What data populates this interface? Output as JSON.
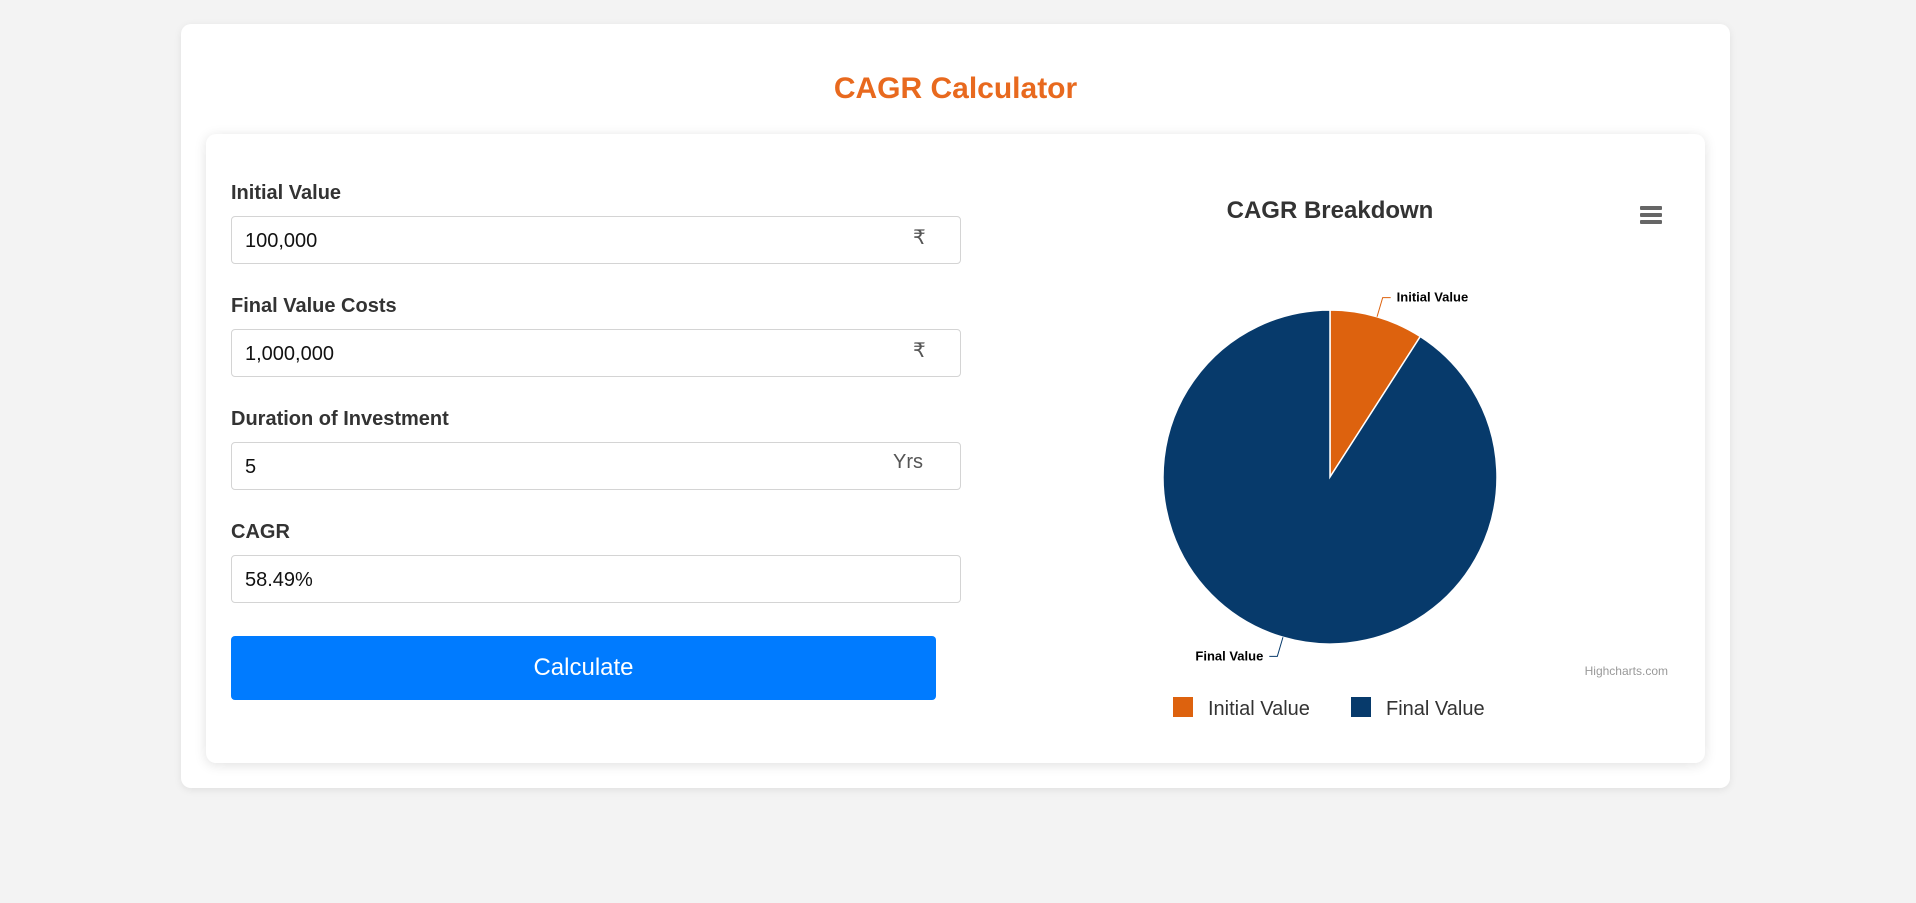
{
  "page": {
    "title": "CAGR Calculator"
  },
  "form": {
    "initial_value": {
      "label": "Initial Value",
      "value": "100,000",
      "suffix": "₹"
    },
    "final_value": {
      "label": "Final Value Costs",
      "value": "1,000,000",
      "suffix": "₹"
    },
    "duration": {
      "label": "Duration of Investment",
      "value": "5",
      "suffix": "Yrs"
    },
    "cagr": {
      "label": "CAGR",
      "value": "58.49%"
    },
    "calculate_label": "Calculate"
  },
  "chart_data": {
    "type": "pie",
    "title": "CAGR Breakdown",
    "categories": [
      "Initial Value",
      "Final Value"
    ],
    "values": [
      100000,
      1000000
    ],
    "colors": [
      "#dd620e",
      "#073a6b"
    ],
    "data_labels": [
      "Initial Value",
      "Final Value"
    ],
    "legend": [
      "Initial Value",
      "Final Value"
    ],
    "legend_position": "bottom",
    "credits": "Highcharts.com",
    "menu_icon": "hamburger-menu-icon"
  }
}
